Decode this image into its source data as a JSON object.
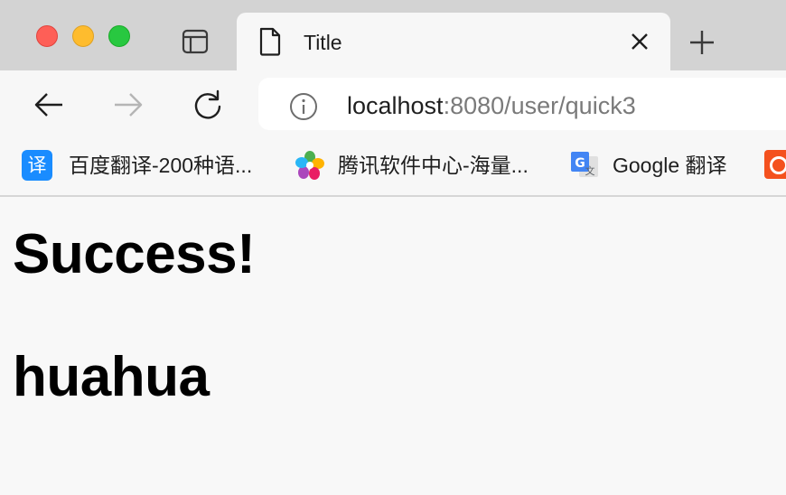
{
  "tab": {
    "title": "Title"
  },
  "address_bar": {
    "host": "localhost",
    "path": ":8080/user/quick3"
  },
  "bookmarks": [
    {
      "icon": "baidu-translate-icon",
      "icon_text": "译",
      "label": "百度翻译-200种语..."
    },
    {
      "icon": "tencent-software-icon",
      "label": "腾讯软件中心-海量..."
    },
    {
      "icon": "google-translate-icon",
      "label": "Google 翻译"
    },
    {
      "icon": "orange-bookmark-icon",
      "label": ""
    }
  ],
  "page": {
    "heading": "Success!",
    "subheading": "huahua"
  },
  "colors": {
    "tabstrip_bg": "#d3d3d3",
    "toolbar_bg": "#f7f7f7",
    "page_bg": "#f8f8f8",
    "close_red": "#fe5f57",
    "minimize_yellow": "#febc2e",
    "zoom_green": "#28c840",
    "baidu_blue": "#1a8cff"
  }
}
